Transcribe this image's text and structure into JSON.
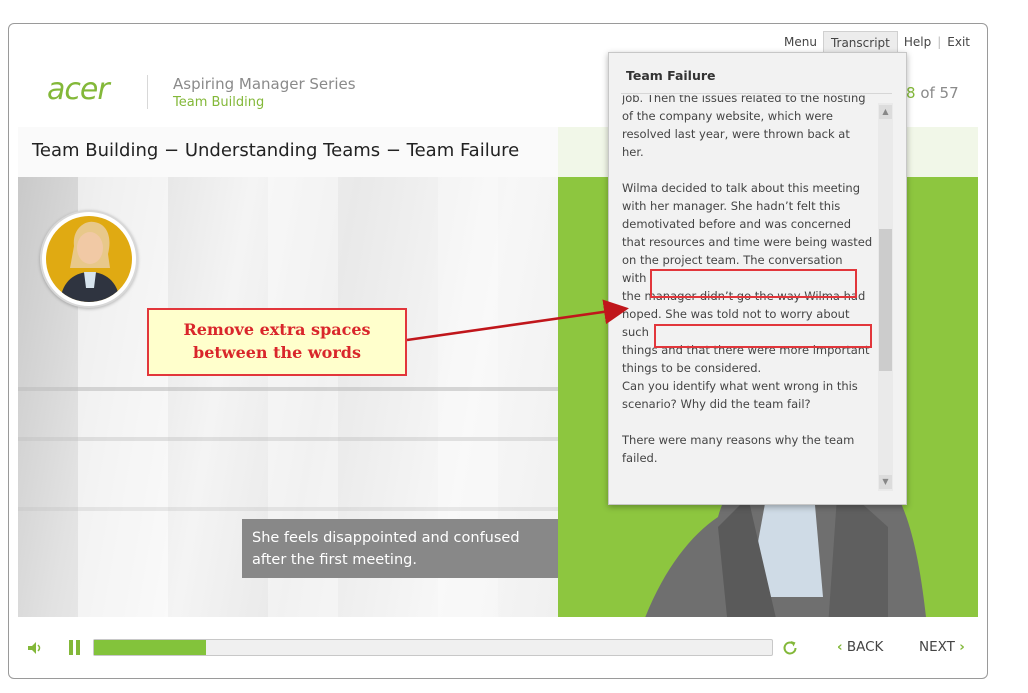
{
  "header": {
    "logo": "acer",
    "series_title": "Aspiring Manager Series",
    "series_subtitle": "Team Building",
    "page_current": "8",
    "page_total_text": " of 57"
  },
  "topnav": {
    "menu": "Menu",
    "transcript": "Transcript",
    "help": "Help",
    "exit": "Exit"
  },
  "slide": {
    "title": "Team Building − Understanding Teams − Team Failure",
    "caption": "She feels disappointed and confused after the first meeting."
  },
  "callout": {
    "line1": "Remove extra spaces",
    "line2": "between the words"
  },
  "transcript": {
    "title": "Team Failure",
    "para1": "job. Then the issues related to the hosting\nof the company website, which were\nresolved last year, were thrown back at\nher.",
    "para2": "Wilma decided to talk about this meeting\nwith her manager. She hadn’t felt this\ndemotivated before and was concerned\nthat resources and time were being wasted\non the project team. The conversation\nwith\nthe manager didn’t go the way Wilma had\nhoped. She was told not to worry about\nsuch\nthings and that there were more important\nthings to be considered.\nCan you identify what went wrong in this\nscenario? Why did the team fail?",
    "para3": "There were many reasons why the team\nfailed."
  },
  "player": {
    "back_label": "BACK",
    "next_label": "NEXT",
    "progress_fraction": 0.165
  },
  "colors": {
    "brand_green": "#83b839",
    "panel_green": "#8dc63f",
    "annotation_red": "#e2363b"
  },
  "icons": [
    "volume-icon",
    "pause-icon",
    "replay-icon",
    "chevron-left-icon",
    "chevron-right-icon",
    "scroll-up-icon",
    "scroll-down-icon"
  ]
}
